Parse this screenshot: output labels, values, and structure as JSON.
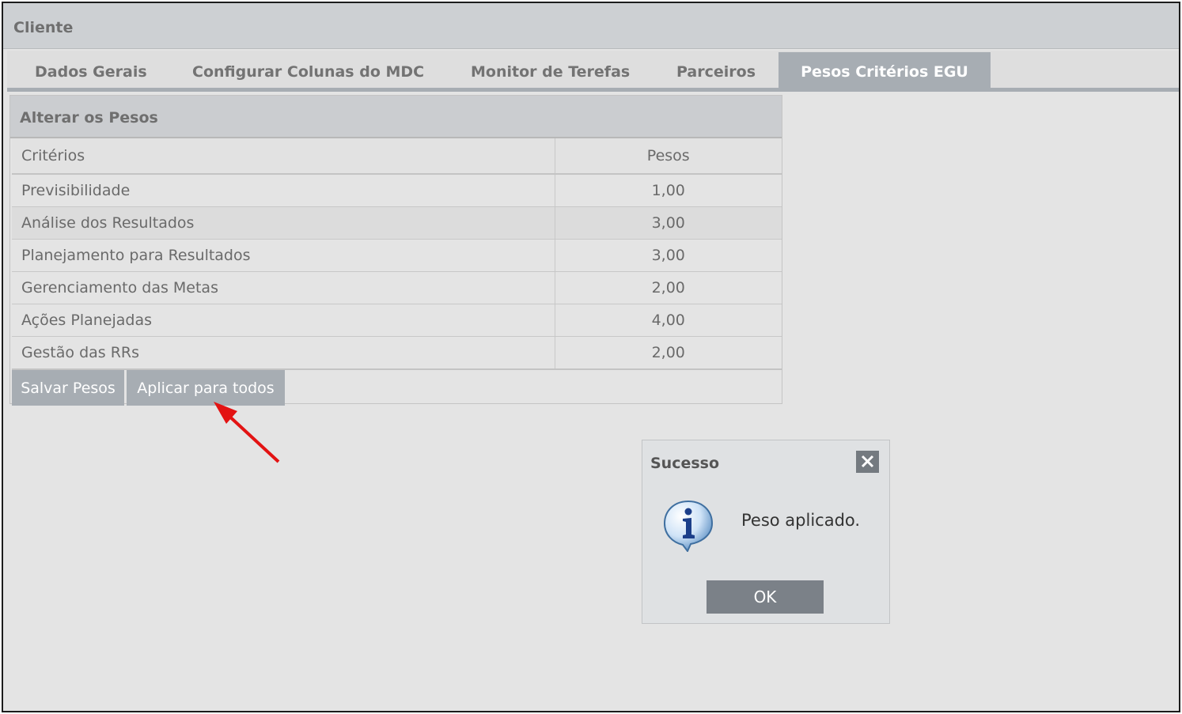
{
  "window": {
    "title": "Cliente"
  },
  "tabs": [
    {
      "label": "Dados Gerais",
      "active": false
    },
    {
      "label": "Configurar Colunas do MDC",
      "active": false
    },
    {
      "label": "Monitor de Terefas",
      "active": false
    },
    {
      "label": "Parceiros",
      "active": false
    },
    {
      "label": "Pesos Critérios EGU",
      "active": true
    }
  ],
  "panel": {
    "title": "Alterar os Pesos",
    "columns": [
      "Critérios",
      "Pesos"
    ],
    "rows": [
      {
        "criterio": "Previsibilidade",
        "peso": "1,00"
      },
      {
        "criterio": "Análise dos Resultados",
        "peso": "3,00"
      },
      {
        "criterio": "Planejamento para Resultados",
        "peso": "3,00"
      },
      {
        "criterio": "Gerenciamento das Metas",
        "peso": "2,00"
      },
      {
        "criterio": "Ações Planejadas",
        "peso": "4,00"
      },
      {
        "criterio": "Gestão das RRs",
        "peso": "2,00"
      }
    ],
    "buttons": {
      "save_label": "Salvar Pesos",
      "apply_all_label": "Aplicar para todos"
    }
  },
  "dialog": {
    "title": "Sucesso",
    "close_icon": "close-icon",
    "info_icon": "info-icon",
    "message": "Peso aplicado.",
    "ok_label": "OK"
  },
  "colors": {
    "accent_tab": "#a7adb3",
    "annotation_arrow": "#e31313",
    "dialog_button": "#7b8188"
  }
}
